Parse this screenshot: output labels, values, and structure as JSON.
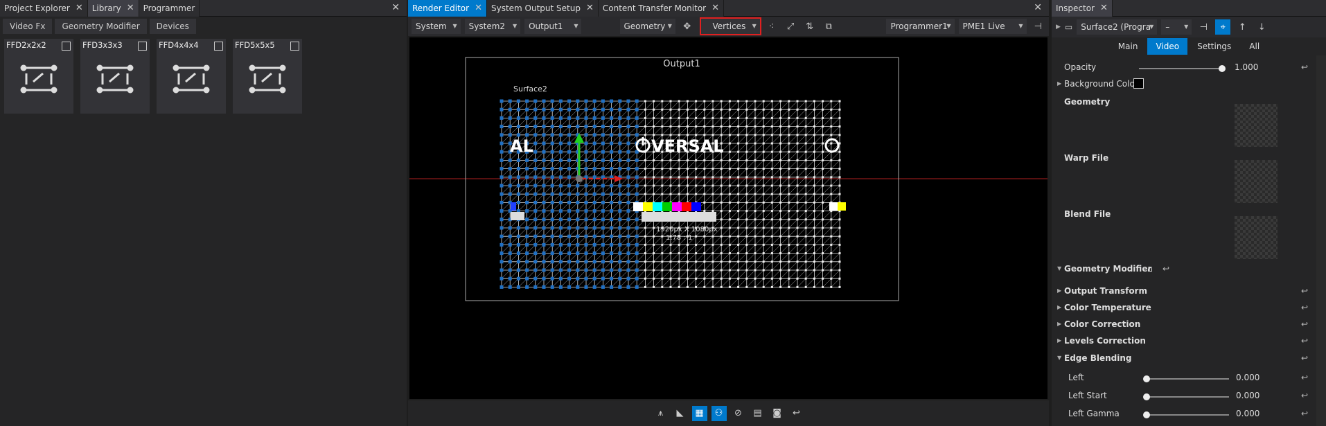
{
  "left": {
    "tabs": [
      {
        "label": "Project Explorer"
      },
      {
        "label": "Library"
      },
      {
        "label": "Programmer"
      }
    ],
    "subtabs": [
      "Video Fx",
      "Geometry Modifier",
      "Devices"
    ],
    "tiles": [
      "FFD2x2x2",
      "FFD3x3x3",
      "FFD4x4x4",
      "FFD5x5x5"
    ]
  },
  "mid": {
    "tabs": [
      {
        "label": "Render Editor"
      },
      {
        "label": "System Output Setup"
      },
      {
        "label": "Content Transfer Monitor"
      }
    ],
    "toolbar": {
      "system": "System",
      "system2": "System2",
      "output": "Output1",
      "geometry": "Geometry",
      "vertices": "Vertices",
      "programmer": "Programmer1",
      "live": "PME1 Live"
    },
    "viewport": {
      "output_label": "Output1",
      "surface_label": "Surface2",
      "logo_left": "AL",
      "logo_center": "VERSAL",
      "size_text": "1920px X 1080px",
      "ratio_text": "1.78 : 1"
    }
  },
  "right": {
    "tabs": [
      {
        "label": "Inspector"
      }
    ],
    "selector": "Surface2 (Progra",
    "selector_dash": "–",
    "itabs": [
      "Main",
      "Video",
      "Settings",
      "All"
    ],
    "opacity_label": "Opacity",
    "opacity_value": "1.000",
    "opacity_level": 1.0,
    "bg_color_label": "Background Color",
    "geometry_label": "Geometry",
    "warp_label": "Warp File",
    "blend_label": "Blend File",
    "geo_mod_label": "Geometry Modifier",
    "sections": [
      "Output Transform",
      "Color Temperature",
      "Color Correction",
      "Levels Correction"
    ],
    "edge_label": "Edge Blending",
    "edge_rows": [
      {
        "label": "Left",
        "value": "0.000"
      },
      {
        "label": "Left Start",
        "value": "0.000"
      },
      {
        "label": "Left Gamma",
        "value": "0.000"
      }
    ]
  },
  "colors": {
    "accent": "#007acc",
    "highlight": "#e02020",
    "vertex": "#1e6fc4"
  }
}
